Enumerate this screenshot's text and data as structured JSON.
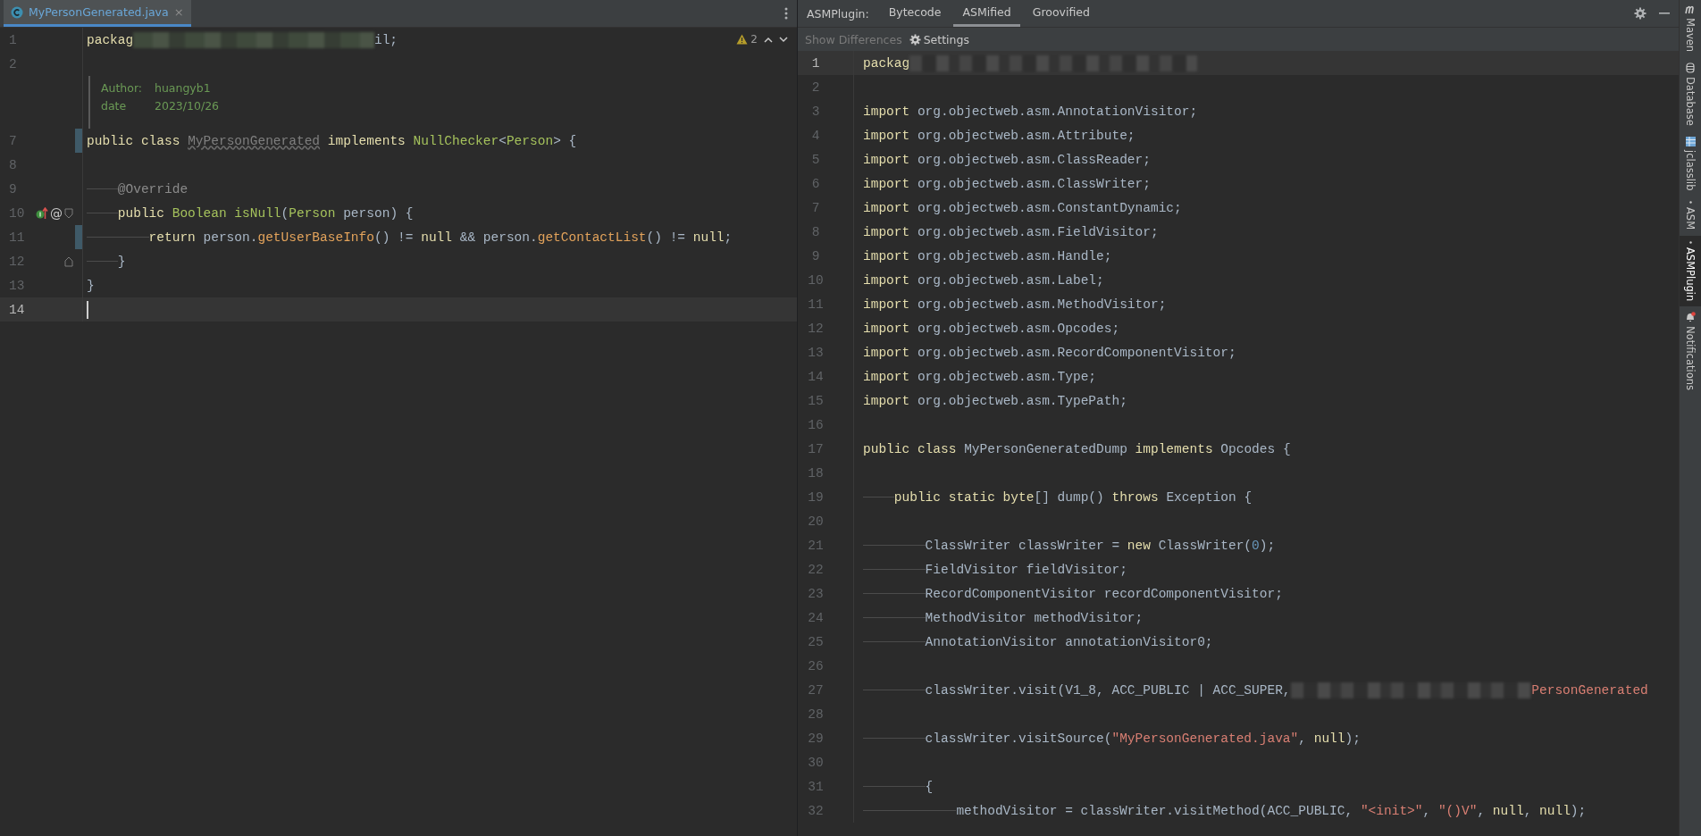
{
  "left_editor": {
    "tab": {
      "label": "MyPersonGenerated.java",
      "selected": true,
      "close": "×"
    },
    "inspection": {
      "count": "2"
    },
    "lines": [
      {
        "kind": "code",
        "number": "1",
        "changed": false,
        "current": false,
        "tokens": [
          {
            "kind": "kw",
            "text": "packag"
          },
          {
            "kind": "redacted"
          },
          {
            "kind": "plain",
            "text": "il;"
          }
        ]
      },
      {
        "kind": "code",
        "number": "2",
        "changed": false,
        "current": false
      },
      {
        "kind": "doc",
        "rows": [
          {
            "label": "Author:",
            "value": "huangyb1"
          },
          {
            "label": "date",
            "value": "2023/10/26"
          }
        ]
      },
      {
        "kind": "code",
        "number": "7",
        "changed": true,
        "current": false,
        "tokens": [
          {
            "kind": "kw",
            "text": "public class "
          },
          {
            "kind": "unused",
            "text": "MyPersonGenerated"
          },
          {
            "kind": "kw",
            "text": " implements "
          },
          {
            "kind": "type",
            "text": "NullChecker"
          },
          {
            "kind": "plain",
            "text": "<"
          },
          {
            "kind": "type",
            "text": "Person"
          },
          {
            "kind": "plain",
            "text": "> {"
          }
        ]
      },
      {
        "kind": "code",
        "number": "8",
        "changed": false,
        "current": false
      },
      {
        "kind": "code",
        "number": "9",
        "changed": false,
        "current": false,
        "tokens": [
          {
            "kind": "indent"
          },
          {
            "kind": "annotation",
            "text": "@Override"
          }
        ]
      },
      {
        "kind": "code",
        "number": "10",
        "changed": false,
        "current": false,
        "fold": {
          "kind": "open"
        },
        "marker": "@",
        "tokens": [
          {
            "kind": "indent"
          },
          {
            "kind": "kw",
            "text": "public "
          },
          {
            "kind": "type",
            "text": "Boolean isNull"
          },
          {
            "kind": "plain",
            "text": "("
          },
          {
            "kind": "type",
            "text": "Person"
          },
          {
            "kind": "plain",
            "text": " person) {"
          }
        ]
      },
      {
        "kind": "code",
        "number": "11",
        "changed": true,
        "current": false,
        "tokens": [
          {
            "kind": "indent"
          },
          {
            "kind": "indent"
          },
          {
            "kind": "kw",
            "text": "return "
          },
          {
            "kind": "plain",
            "text": "person."
          },
          {
            "kind": "method",
            "text": "getUserBaseInfo"
          },
          {
            "kind": "plain",
            "text": "() != "
          },
          {
            "kind": "kw",
            "text": "null"
          },
          {
            "kind": "plain",
            "text": " && person."
          },
          {
            "kind": "method",
            "text": "getContactList"
          },
          {
            "kind": "plain",
            "text": "() != "
          },
          {
            "kind": "kw",
            "text": "null"
          },
          {
            "kind": "plain",
            "text": ";"
          }
        ]
      },
      {
        "kind": "code",
        "number": "12",
        "changed": false,
        "current": false,
        "fold": {
          "kind": "close"
        },
        "tokens": [
          {
            "kind": "indent"
          },
          {
            "kind": "plain",
            "text": "}"
          }
        ]
      },
      {
        "kind": "code",
        "number": "13",
        "changed": false,
        "current": false,
        "tokens": [
          {
            "kind": "plain",
            "text": "}"
          }
        ]
      },
      {
        "kind": "code",
        "number": "14",
        "changed": false,
        "current": true
      }
    ]
  },
  "asm_panel": {
    "title": "ASMPlugin:",
    "tabs": [
      {
        "label": "Bytecode",
        "selected": false
      },
      {
        "label": "ASMified",
        "selected": true
      },
      {
        "label": "Groovified",
        "selected": false
      }
    ],
    "toolbar": [
      {
        "label": "Show Differences",
        "disabled": true,
        "kind": "plain"
      },
      {
        "label": "Settings",
        "disabled": false,
        "kind": "gear"
      }
    ],
    "lines": [
      {
        "number": "1",
        "current": true,
        "tokens": [
          {
            "kind": "kw",
            "text": "packag"
          },
          {
            "kind": "redacted_long"
          }
        ]
      },
      {
        "number": "2",
        "current": false
      },
      {
        "number": "3",
        "current": false,
        "tokens": [
          {
            "kind": "kw",
            "text": "import "
          },
          {
            "kind": "plain",
            "text": "org.objectweb.asm.AnnotationVisitor;"
          }
        ]
      },
      {
        "number": "4",
        "current": false,
        "tokens": [
          {
            "kind": "kw",
            "text": "import "
          },
          {
            "kind": "plain",
            "text": "org.objectweb.asm.Attribute;"
          }
        ]
      },
      {
        "number": "5",
        "current": false,
        "tokens": [
          {
            "kind": "kw",
            "text": "import "
          },
          {
            "kind": "plain",
            "text": "org.objectweb.asm.ClassReader;"
          }
        ]
      },
      {
        "number": "6",
        "current": false,
        "tokens": [
          {
            "kind": "kw",
            "text": "import "
          },
          {
            "kind": "plain",
            "text": "org.objectweb.asm.ClassWriter;"
          }
        ]
      },
      {
        "number": "7",
        "current": false,
        "tokens": [
          {
            "kind": "kw",
            "text": "import "
          },
          {
            "kind": "plain",
            "text": "org.objectweb.asm.ConstantDynamic;"
          }
        ]
      },
      {
        "number": "8",
        "current": false,
        "tokens": [
          {
            "kind": "kw",
            "text": "import "
          },
          {
            "kind": "plain",
            "text": "org.objectweb.asm.FieldVisitor;"
          }
        ]
      },
      {
        "number": "9",
        "current": false,
        "tokens": [
          {
            "kind": "kw",
            "text": "import "
          },
          {
            "kind": "plain",
            "text": "org.objectweb.asm.Handle;"
          }
        ]
      },
      {
        "number": "10",
        "current": false,
        "tokens": [
          {
            "kind": "kw",
            "text": "import "
          },
          {
            "kind": "plain",
            "text": "org.objectweb.asm.Label;"
          }
        ]
      },
      {
        "number": "11",
        "current": false,
        "tokens": [
          {
            "kind": "kw",
            "text": "import "
          },
          {
            "kind": "plain",
            "text": "org.objectweb.asm.MethodVisitor;"
          }
        ]
      },
      {
        "number": "12",
        "current": false,
        "tokens": [
          {
            "kind": "kw",
            "text": "import "
          },
          {
            "kind": "plain",
            "text": "org.objectweb.asm.Opcodes;"
          }
        ]
      },
      {
        "number": "13",
        "current": false,
        "tokens": [
          {
            "kind": "kw",
            "text": "import "
          },
          {
            "kind": "plain",
            "text": "org.objectweb.asm.RecordComponentVisitor;"
          }
        ]
      },
      {
        "number": "14",
        "current": false,
        "tokens": [
          {
            "kind": "kw",
            "text": "import "
          },
          {
            "kind": "plain",
            "text": "org.objectweb.asm.Type;"
          }
        ]
      },
      {
        "number": "15",
        "current": false,
        "tokens": [
          {
            "kind": "kw",
            "text": "import "
          },
          {
            "kind": "plain",
            "text": "org.objectweb.asm.TypePath;"
          }
        ]
      },
      {
        "number": "16",
        "current": false
      },
      {
        "number": "17",
        "current": false,
        "tokens": [
          {
            "kind": "kw",
            "text": "public class "
          },
          {
            "kind": "plain",
            "text": "MyPersonGeneratedDump "
          },
          {
            "kind": "kw",
            "text": "implements "
          },
          {
            "kind": "plain",
            "text": "Opcodes {"
          }
        ]
      },
      {
        "number": "18",
        "current": false
      },
      {
        "number": "19",
        "current": false,
        "tokens": [
          {
            "kind": "indent"
          },
          {
            "kind": "kw",
            "text": "public static byte"
          },
          {
            "kind": "plain",
            "text": "[] dump() "
          },
          {
            "kind": "kw",
            "text": "throws "
          },
          {
            "kind": "plain",
            "text": "Exception {"
          }
        ]
      },
      {
        "number": "20",
        "current": false
      },
      {
        "number": "21",
        "current": false,
        "tokens": [
          {
            "kind": "indent"
          },
          {
            "kind": "indent"
          },
          {
            "kind": "plain",
            "text": "ClassWriter classWriter = "
          },
          {
            "kind": "kw",
            "text": "new "
          },
          {
            "kind": "plain",
            "text": "ClassWriter("
          },
          {
            "kind": "num",
            "text": "0"
          },
          {
            "kind": "plain",
            "text": ");"
          }
        ]
      },
      {
        "number": "22",
        "current": false,
        "tokens": [
          {
            "kind": "indent"
          },
          {
            "kind": "indent"
          },
          {
            "kind": "plain",
            "text": "FieldVisitor fieldVisitor;"
          }
        ]
      },
      {
        "number": "23",
        "current": false,
        "tokens": [
          {
            "kind": "indent"
          },
          {
            "kind": "indent"
          },
          {
            "kind": "plain",
            "text": "RecordComponentVisitor recordComponentVisitor;"
          }
        ]
      },
      {
        "number": "24",
        "current": false,
        "tokens": [
          {
            "kind": "indent"
          },
          {
            "kind": "indent"
          },
          {
            "kind": "plain",
            "text": "MethodVisitor methodVisitor;"
          }
        ]
      },
      {
        "number": "25",
        "current": false,
        "tokens": [
          {
            "kind": "indent"
          },
          {
            "kind": "indent"
          },
          {
            "kind": "plain",
            "text": "AnnotationVisitor annotationVisitor0;"
          }
        ]
      },
      {
        "number": "26",
        "current": false
      },
      {
        "number": "27",
        "current": false,
        "tokens": [
          {
            "kind": "indent"
          },
          {
            "kind": "indent"
          },
          {
            "kind": "plain",
            "text": "classWriter.visit(V1_8, ACC_PUBLIC | ACC_SUPER,"
          },
          {
            "kind": "redacted"
          },
          {
            "kind": "string",
            "text": "PersonGenerated"
          }
        ]
      },
      {
        "number": "28",
        "current": false
      },
      {
        "number": "29",
        "current": false,
        "tokens": [
          {
            "kind": "indent"
          },
          {
            "kind": "indent"
          },
          {
            "kind": "plain",
            "text": "classWriter.visitSource("
          },
          {
            "kind": "string",
            "text": "\"MyPersonGenerated.java\""
          },
          {
            "kind": "plain",
            "text": ", "
          },
          {
            "kind": "kw",
            "text": "null"
          },
          {
            "kind": "plain",
            "text": ");"
          }
        ]
      },
      {
        "number": "30",
        "current": false
      },
      {
        "number": "31",
        "current": false,
        "tokens": [
          {
            "kind": "indent"
          },
          {
            "kind": "indent"
          },
          {
            "kind": "plain",
            "text": "{"
          }
        ]
      },
      {
        "number": "32",
        "current": false,
        "tokens": [
          {
            "kind": "indent"
          },
          {
            "kind": "indent"
          },
          {
            "kind": "indent"
          },
          {
            "kind": "plain",
            "text": "methodVisitor = classWriter.visitMethod(ACC_PUBLIC, "
          },
          {
            "kind": "string",
            "text": "\"<init>\""
          },
          {
            "kind": "plain",
            "text": ", "
          },
          {
            "kind": "string",
            "text": "\"()V\""
          },
          {
            "kind": "plain",
            "text": ", "
          },
          {
            "kind": "kw",
            "text": "null"
          },
          {
            "kind": "plain",
            "text": ", "
          },
          {
            "kind": "kw",
            "text": "null"
          },
          {
            "kind": "plain",
            "text": ");"
          }
        ]
      }
    ]
  },
  "tool_strip": [
    {
      "label": "Maven",
      "kind": "maven",
      "selected": false
    },
    {
      "label": "Database",
      "kind": "database",
      "selected": false
    },
    {
      "label": "jclasslib",
      "kind": "grid",
      "selected": false
    },
    {
      "label": "ASM",
      "kind": "dot",
      "selected": false
    },
    {
      "label": "ASMPlugin",
      "kind": "dot",
      "selected": true
    },
    {
      "label": "Notifications",
      "kind": "bell",
      "selected": false
    }
  ]
}
